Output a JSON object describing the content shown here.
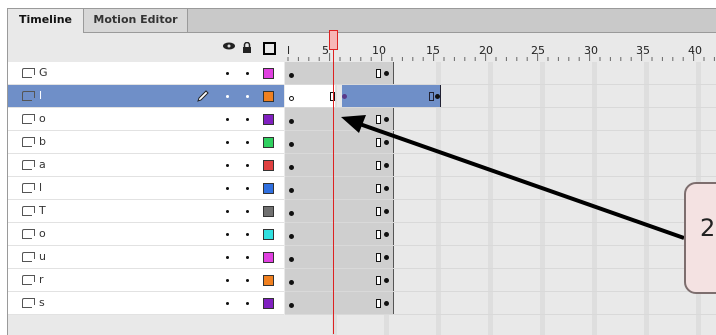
{
  "tabs": [
    {
      "label": "Timeline",
      "active": true
    },
    {
      "label": "Motion Editor",
      "active": false
    }
  ],
  "ruler": {
    "labels": [
      "l",
      "5",
      "10",
      "15",
      "20",
      "25",
      "30",
      "35",
      "40"
    ],
    "current_frame": 6
  },
  "header_icons": [
    "eye-icon",
    "lock-icon",
    "outline-icon"
  ],
  "layers": [
    {
      "name": "G",
      "color": "#e040e0",
      "selected": false
    },
    {
      "name": "l",
      "color": "#f08020",
      "selected": true
    },
    {
      "name": "o",
      "color": "#8020c0",
      "selected": false
    },
    {
      "name": "b",
      "color": "#30d060",
      "selected": false
    },
    {
      "name": "a",
      "color": "#e04040",
      "selected": false
    },
    {
      "name": "l",
      "color": "#3070e0",
      "selected": false
    },
    {
      "name": "T",
      "color": "#707070",
      "selected": false
    },
    {
      "name": "o",
      "color": "#30e0e0",
      "selected": false
    },
    {
      "name": "u",
      "color": "#e040e0",
      "selected": false
    },
    {
      "name": "r",
      "color": "#f08020",
      "selected": false
    },
    {
      "name": "s",
      "color": "#8020c0",
      "selected": false
    }
  ],
  "callout": {
    "text": "2"
  },
  "colors": {
    "selection": "#6f8fc8",
    "playhead": "#d22222",
    "panel": "#e9e9e9"
  }
}
